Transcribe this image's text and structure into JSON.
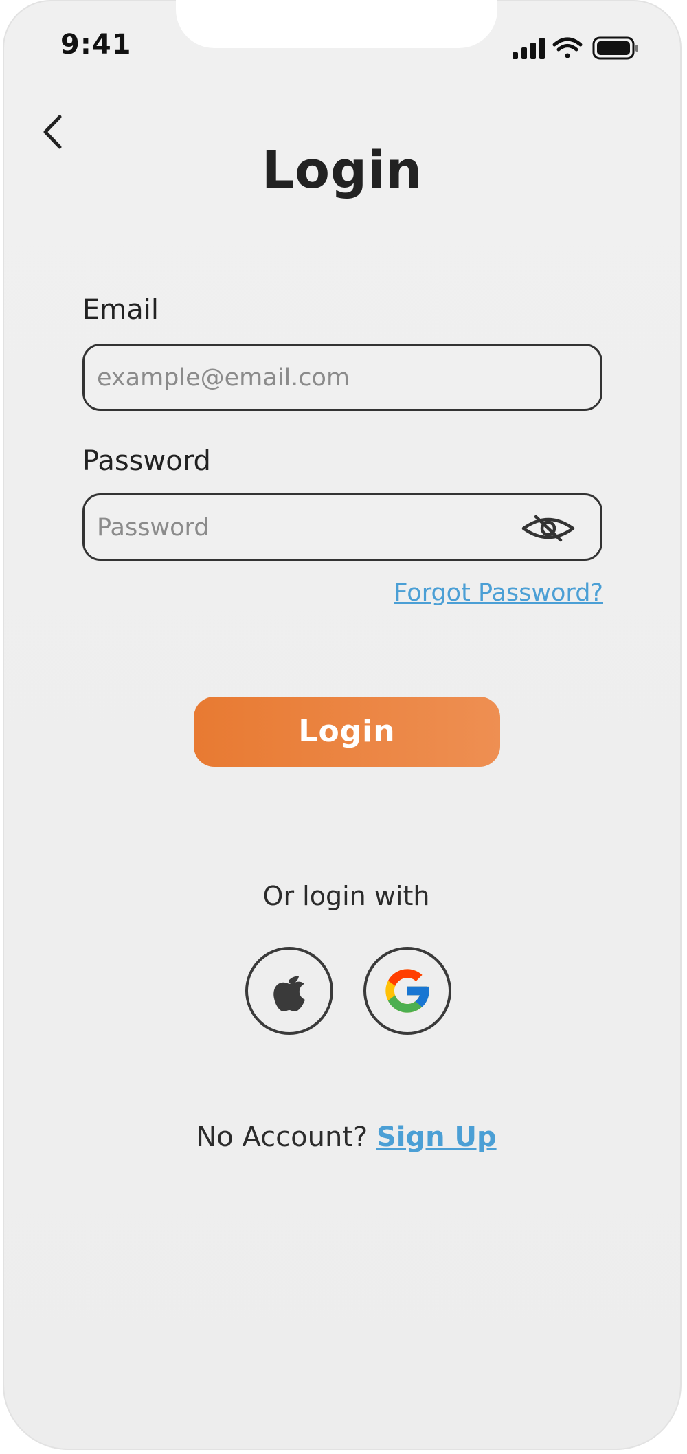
{
  "status_bar": {
    "time": "9:41"
  },
  "header": {
    "title": "Login"
  },
  "form": {
    "email_label": "Email",
    "email_placeholder": "example@email.com",
    "password_label": "Password",
    "password_placeholder": "Password",
    "forgot_link": "Forgot Password?",
    "login_button": "Login"
  },
  "social": {
    "prompt": "Or login with",
    "providers": [
      {
        "name": "apple",
        "icon": "apple-icon"
      },
      {
        "name": "google",
        "icon": "google-icon"
      }
    ]
  },
  "footer": {
    "no_account_text": "No Account?",
    "signup_link": "Sign Up"
  },
  "colors": {
    "accent_orange": "#e87a32",
    "link_blue": "#4b9fd5",
    "background": "#efefef"
  }
}
